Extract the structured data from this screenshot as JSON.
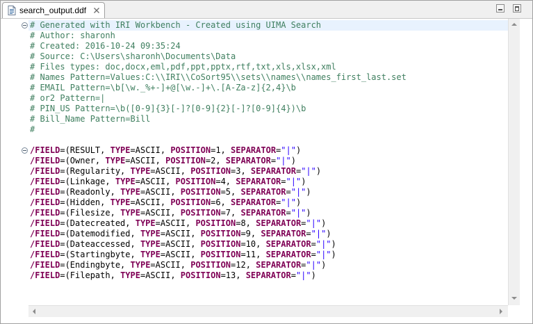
{
  "tab": {
    "file_name": "search_output.ddf",
    "close_glyph": "✕"
  },
  "editor": {
    "lines": [
      [
        {
          "t": "# Generated with IRI Workbench - Created using UIMA Search",
          "c": "cm"
        }
      ],
      [
        {
          "t": "# Author: sharonh",
          "c": "cm"
        }
      ],
      [
        {
          "t": "# Created: 2016-10-24 09:35:24",
          "c": "cm"
        }
      ],
      [
        {
          "t": "# Source: C:\\Users\\sharonh\\Documents\\Data",
          "c": "cm"
        }
      ],
      [
        {
          "t": "# Files types: doc,docx,eml,pdf,ppt,pptx,rtf,txt,xls,xlsx,xml",
          "c": "cm"
        }
      ],
      [
        {
          "t": "# Names Pattern=Values:C:\\\\IRI\\\\CoSort95\\\\sets\\\\names\\\\names_first_last.set",
          "c": "cm"
        }
      ],
      [
        {
          "t": "# EMAIL Pattern=\\b[\\w._%+-]+@[\\w.-]+\\.[A-Za-z]{2,4}\\b",
          "c": "cm"
        }
      ],
      [
        {
          "t": "# or2 Pattern=|",
          "c": "cm"
        }
      ],
      [
        {
          "t": "# PIN_US Pattern=\\b([0-9]{3}[-]?[0-9]{2}[-]?[0-9]{4})\\b",
          "c": "cm"
        }
      ],
      [
        {
          "t": "# Bill_Name Pattern=Bill",
          "c": "cm"
        }
      ],
      [
        {
          "t": "#",
          "c": "cm"
        }
      ],
      [],
      [
        {
          "t": "/FIELD",
          "c": "kw"
        },
        {
          "t": "=(RESULT, ",
          "c": "tx"
        },
        {
          "t": "TYPE",
          "c": "kw"
        },
        {
          "t": "=ASCII, ",
          "c": "tx"
        },
        {
          "t": "POSITION",
          "c": "kw"
        },
        {
          "t": "=1, ",
          "c": "tx"
        },
        {
          "t": "SEPARATOR",
          "c": "kw"
        },
        {
          "t": "=",
          "c": "tx"
        },
        {
          "t": "\"|\"",
          "c": "st"
        },
        {
          "t": ")",
          "c": "tx"
        }
      ],
      [
        {
          "t": "/FIELD",
          "c": "kw"
        },
        {
          "t": "=(Owner, ",
          "c": "tx"
        },
        {
          "t": "TYPE",
          "c": "kw"
        },
        {
          "t": "=ASCII, ",
          "c": "tx"
        },
        {
          "t": "POSITION",
          "c": "kw"
        },
        {
          "t": "=2, ",
          "c": "tx"
        },
        {
          "t": "SEPARATOR",
          "c": "kw"
        },
        {
          "t": "=",
          "c": "tx"
        },
        {
          "t": "\"|\"",
          "c": "st"
        },
        {
          "t": ")",
          "c": "tx"
        }
      ],
      [
        {
          "t": "/FIELD",
          "c": "kw"
        },
        {
          "t": "=(Regularity, ",
          "c": "tx"
        },
        {
          "t": "TYPE",
          "c": "kw"
        },
        {
          "t": "=ASCII, ",
          "c": "tx"
        },
        {
          "t": "POSITION",
          "c": "kw"
        },
        {
          "t": "=3, ",
          "c": "tx"
        },
        {
          "t": "SEPARATOR",
          "c": "kw"
        },
        {
          "t": "=",
          "c": "tx"
        },
        {
          "t": "\"|\"",
          "c": "st"
        },
        {
          "t": ")",
          "c": "tx"
        }
      ],
      [
        {
          "t": "/FIELD",
          "c": "kw"
        },
        {
          "t": "=(Linkage, ",
          "c": "tx"
        },
        {
          "t": "TYPE",
          "c": "kw"
        },
        {
          "t": "=ASCII, ",
          "c": "tx"
        },
        {
          "t": "POSITION",
          "c": "kw"
        },
        {
          "t": "=4, ",
          "c": "tx"
        },
        {
          "t": "SEPARATOR",
          "c": "kw"
        },
        {
          "t": "=",
          "c": "tx"
        },
        {
          "t": "\"|\"",
          "c": "st"
        },
        {
          "t": ")",
          "c": "tx"
        }
      ],
      [
        {
          "t": "/FIELD",
          "c": "kw"
        },
        {
          "t": "=(Readonly, ",
          "c": "tx"
        },
        {
          "t": "TYPE",
          "c": "kw"
        },
        {
          "t": "=ASCII, ",
          "c": "tx"
        },
        {
          "t": "POSITION",
          "c": "kw"
        },
        {
          "t": "=5, ",
          "c": "tx"
        },
        {
          "t": "SEPARATOR",
          "c": "kw"
        },
        {
          "t": "=",
          "c": "tx"
        },
        {
          "t": "\"|\"",
          "c": "st"
        },
        {
          "t": ")",
          "c": "tx"
        }
      ],
      [
        {
          "t": "/FIELD",
          "c": "kw"
        },
        {
          "t": "=(Hidden, ",
          "c": "tx"
        },
        {
          "t": "TYPE",
          "c": "kw"
        },
        {
          "t": "=ASCII, ",
          "c": "tx"
        },
        {
          "t": "POSITION",
          "c": "kw"
        },
        {
          "t": "=6, ",
          "c": "tx"
        },
        {
          "t": "SEPARATOR",
          "c": "kw"
        },
        {
          "t": "=",
          "c": "tx"
        },
        {
          "t": "\"|\"",
          "c": "st"
        },
        {
          "t": ")",
          "c": "tx"
        }
      ],
      [
        {
          "t": "/FIELD",
          "c": "kw"
        },
        {
          "t": "=(Filesize, ",
          "c": "tx"
        },
        {
          "t": "TYPE",
          "c": "kw"
        },
        {
          "t": "=ASCII, ",
          "c": "tx"
        },
        {
          "t": "POSITION",
          "c": "kw"
        },
        {
          "t": "=7, ",
          "c": "tx"
        },
        {
          "t": "SEPARATOR",
          "c": "kw"
        },
        {
          "t": "=",
          "c": "tx"
        },
        {
          "t": "\"|\"",
          "c": "st"
        },
        {
          "t": ")",
          "c": "tx"
        }
      ],
      [
        {
          "t": "/FIELD",
          "c": "kw"
        },
        {
          "t": "=(Datecreated, ",
          "c": "tx"
        },
        {
          "t": "TYPE",
          "c": "kw"
        },
        {
          "t": "=ASCII, ",
          "c": "tx"
        },
        {
          "t": "POSITION",
          "c": "kw"
        },
        {
          "t": "=8, ",
          "c": "tx"
        },
        {
          "t": "SEPARATOR",
          "c": "kw"
        },
        {
          "t": "=",
          "c": "tx"
        },
        {
          "t": "\"|\"",
          "c": "st"
        },
        {
          "t": ")",
          "c": "tx"
        }
      ],
      [
        {
          "t": "/FIELD",
          "c": "kw"
        },
        {
          "t": "=(Datemodified, ",
          "c": "tx"
        },
        {
          "t": "TYPE",
          "c": "kw"
        },
        {
          "t": "=ASCII, ",
          "c": "tx"
        },
        {
          "t": "POSITION",
          "c": "kw"
        },
        {
          "t": "=9, ",
          "c": "tx"
        },
        {
          "t": "SEPARATOR",
          "c": "kw"
        },
        {
          "t": "=",
          "c": "tx"
        },
        {
          "t": "\"|\"",
          "c": "st"
        },
        {
          "t": ")",
          "c": "tx"
        }
      ],
      [
        {
          "t": "/FIELD",
          "c": "kw"
        },
        {
          "t": "=(Dateaccessed, ",
          "c": "tx"
        },
        {
          "t": "TYPE",
          "c": "kw"
        },
        {
          "t": "=ASCII, ",
          "c": "tx"
        },
        {
          "t": "POSITION",
          "c": "kw"
        },
        {
          "t": "=10, ",
          "c": "tx"
        },
        {
          "t": "SEPARATOR",
          "c": "kw"
        },
        {
          "t": "=",
          "c": "tx"
        },
        {
          "t": "\"|\"",
          "c": "st"
        },
        {
          "t": ")",
          "c": "tx"
        }
      ],
      [
        {
          "t": "/FIELD",
          "c": "kw"
        },
        {
          "t": "=(Startingbyte, ",
          "c": "tx"
        },
        {
          "t": "TYPE",
          "c": "kw"
        },
        {
          "t": "=ASCII, ",
          "c": "tx"
        },
        {
          "t": "POSITION",
          "c": "kw"
        },
        {
          "t": "=11, ",
          "c": "tx"
        },
        {
          "t": "SEPARATOR",
          "c": "kw"
        },
        {
          "t": "=",
          "c": "tx"
        },
        {
          "t": "\"|\"",
          "c": "st"
        },
        {
          "t": ")",
          "c": "tx"
        }
      ],
      [
        {
          "t": "/FIELD",
          "c": "kw"
        },
        {
          "t": "=(Endingbyte, ",
          "c": "tx"
        },
        {
          "t": "TYPE",
          "c": "kw"
        },
        {
          "t": "=ASCII, ",
          "c": "tx"
        },
        {
          "t": "POSITION",
          "c": "kw"
        },
        {
          "t": "=12, ",
          "c": "tx"
        },
        {
          "t": "SEPARATOR",
          "c": "kw"
        },
        {
          "t": "=",
          "c": "tx"
        },
        {
          "t": "\"|\"",
          "c": "st"
        },
        {
          "t": ")",
          "c": "tx"
        }
      ],
      [
        {
          "t": "/FIELD",
          "c": "kw"
        },
        {
          "t": "=(Filepath, ",
          "c": "tx"
        },
        {
          "t": "TYPE",
          "c": "kw"
        },
        {
          "t": "=ASCII, ",
          "c": "tx"
        },
        {
          "t": "POSITION",
          "c": "kw"
        },
        {
          "t": "=13, ",
          "c": "tx"
        },
        {
          "t": "SEPARATOR",
          "c": "kw"
        },
        {
          "t": "=",
          "c": "tx"
        },
        {
          "t": "\"|\"",
          "c": "st"
        },
        {
          "t": ")",
          "c": "tx"
        }
      ]
    ]
  },
  "colors": {
    "comment": "#3f7f5f",
    "keyword": "#7f0055",
    "text": "#000000",
    "string": "#2a00ff",
    "current_line": "#e8f2fe"
  },
  "icons": {
    "tab_file": "file-icon",
    "tab_close": "close-icon",
    "fold": "fold-collapse-icon",
    "minimize": "minimize-icon",
    "maximize": "maximize-icon"
  }
}
